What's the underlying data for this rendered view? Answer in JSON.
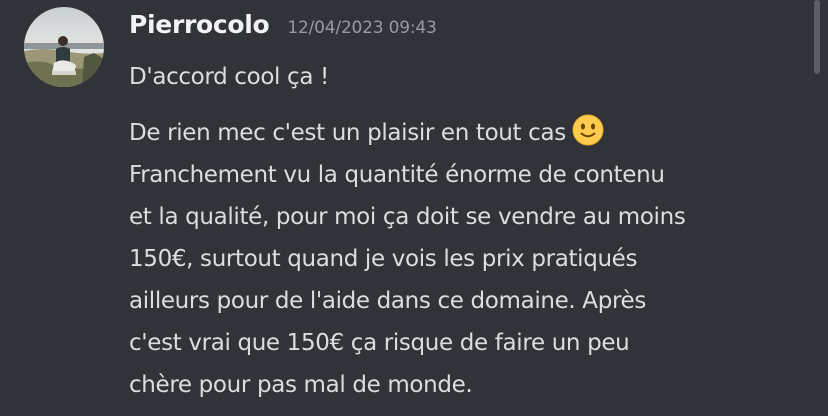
{
  "message": {
    "author": "Pierrocolo",
    "timestamp": "12/04/2023 09:43",
    "avatar_icon": "user-avatar-photo",
    "lines": [
      "D'accord cool ça !"
    ],
    "paragraph": {
      "lines": [
        "De rien mec c'est un plaisir en tout cas",
        "Franchement vu la quantité énorme de contenu",
        "et la qualité, pour moi ça doit se vendre au moins",
        "150€, surtout quand je vois les prix pratiqués",
        "ailleurs pour de l'aide dans ce domaine. Après",
        "c'est vrai que 150€ ça risque de faire un peu",
        "chère pour pas mal de monde."
      ],
      "emoji": "slightly-smiling-face-icon"
    }
  },
  "colors": {
    "background": "#313338",
    "username": "#f2f3f5",
    "text": "#dbdee1",
    "timestamp": "#949ba4",
    "scrollbar": "#5b5e65"
  }
}
